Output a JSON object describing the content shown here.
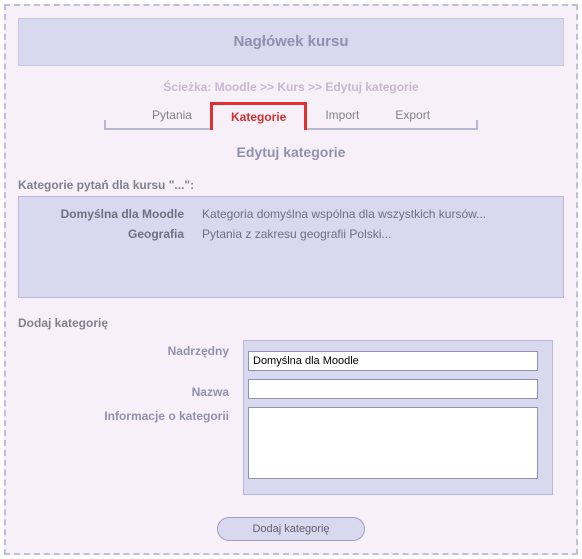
{
  "header": {
    "title": "Nagłówek kursu"
  },
  "breadcrumb": "Ścieżka: Moodle >> Kurs >> Edytuj kategorie",
  "tabs": [
    {
      "label": "Pytania",
      "active": false
    },
    {
      "label": "Kategorie",
      "active": true
    },
    {
      "label": "Import",
      "active": false
    },
    {
      "label": "Export",
      "active": false
    }
  ],
  "section_title": "Edytuj kategorie",
  "categories_heading": "Kategorie pytań dla kursu \"...\":",
  "categories": [
    {
      "name": "Domyślna dla Moodle",
      "desc": "Kategoria domyślna wspólna dla wszystkich kursów..."
    },
    {
      "name": "Geografia",
      "desc": "Pytania z zakresu geografii Polski..."
    }
  ],
  "form": {
    "heading": "Dodaj kategorię",
    "labels": {
      "parent": "Nadrzędny",
      "name": "Nazwa",
      "info": "Informacje o kategorii"
    },
    "values": {
      "parent": "Domyślna dla Moodle",
      "name": "",
      "info": ""
    },
    "submit_label": "Dodaj kategorię"
  }
}
